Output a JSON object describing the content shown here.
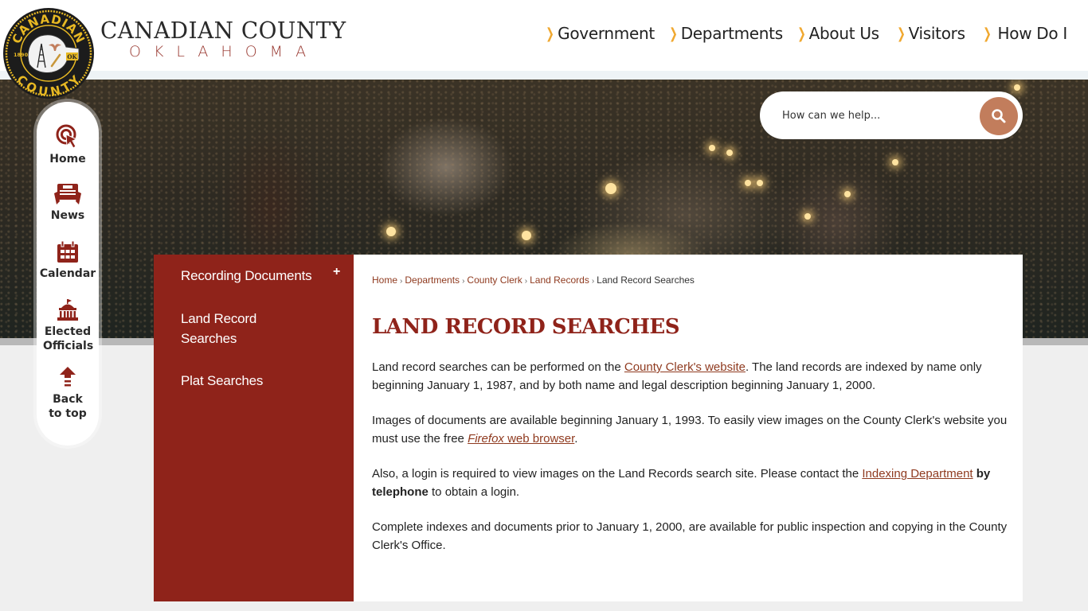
{
  "brand": {
    "seal_top_text": "CANADIAN",
    "seal_bottom_text": "COUNTY",
    "seal_year": "1890",
    "seal_state": "OK",
    "name": "CANADIAN COUNTY",
    "state": "OKLAHOMA",
    "colors": {
      "primary": "#8f231a",
      "accent": "#f0a830",
      "search_button": "#c27d5c",
      "seal_gold": "#e8b923"
    }
  },
  "main_nav": [
    {
      "label": "Government",
      "icon": "chevron-right-icon"
    },
    {
      "label": "Departments",
      "icon": "chevron-right-icon"
    },
    {
      "label": "About Us",
      "icon": "chevron-right-icon"
    },
    {
      "label": "Visitors",
      "icon": "chevron-right-icon"
    },
    {
      "label": "How Do I",
      "icon": "chevron-right-icon"
    }
  ],
  "search": {
    "placeholder": "How can we help...",
    "value": "",
    "button_icon": "search-icon"
  },
  "quick_links": [
    {
      "label": "Home",
      "icon": "pointer-click-icon"
    },
    {
      "label": "News",
      "icon": "newspaper-icon"
    },
    {
      "label": "Calendar",
      "icon": "calendar-icon"
    },
    {
      "label": "Elected Officials",
      "icon": "capitol-building-icon"
    },
    {
      "label": "Back to top",
      "icon": "arrow-up-icon"
    }
  ],
  "side_nav": {
    "items": [
      {
        "label": "Recording Documents",
        "expandable": true,
        "expand_icon": "plus-icon"
      },
      {
        "label": "Land Record Searches",
        "expandable": false
      },
      {
        "label": "Plat Searches",
        "expandable": false
      }
    ]
  },
  "breadcrumb": {
    "items": [
      "Home",
      "Departments",
      "County Clerk",
      "Land Records"
    ],
    "current": "Land Record Searches",
    "separator": "›"
  },
  "page": {
    "title": "LAND RECORD SEARCHES",
    "paragraphs": {
      "p1": {
        "before": "Land record searches can be performed on the ",
        "link": "County Clerk's website",
        "after": ". The land records are indexed by name only beginning January 1, 1987, and by both name and legal description beginning January 1, 2000."
      },
      "p2": {
        "before": "Images of documents are available beginning January 1, 1993. To easily view images on the County Clerk's website you must use the free ",
        "link_italic": "Firefox",
        "link_rest": " web browser",
        "after": "."
      },
      "p3": {
        "before": "Also, a login is required to view images on the Land Records search site. Please contact the ",
        "link": "Indexing Department",
        "bold": " by telephone",
        "after": " to obtain a login."
      },
      "p4": {
        "text": "Complete indexes and documents prior to January 1, 2000, are available for public inspection and copying in the County Clerk's Office."
      }
    }
  }
}
